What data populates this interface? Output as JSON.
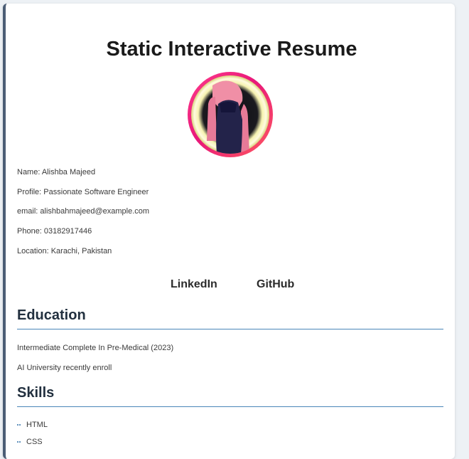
{
  "header": {
    "title": "Static Interactive Resume"
  },
  "profile": {
    "name": "Name: Alishba Majeed",
    "profile": "Profile: Passionate Software Engineer",
    "email": "email: alishbahmajeed@example.com",
    "phone": "Phone: 03182917446",
    "location": "Location: Karachi, Pakistan"
  },
  "links": {
    "linkedin": "LinkedIn",
    "github": "GitHub"
  },
  "education": {
    "heading": "Education",
    "items": [
      "Intermediate Complete In Pre-Medical (2023)",
      "AI University recently enroll"
    ]
  },
  "skills": {
    "heading": "Skills",
    "items": [
      "HTML",
      "CSS"
    ]
  },
  "colors": {
    "accent": "#4a86b8",
    "card_border": "#4b5d75",
    "avatar_ring": "#e8177a"
  }
}
